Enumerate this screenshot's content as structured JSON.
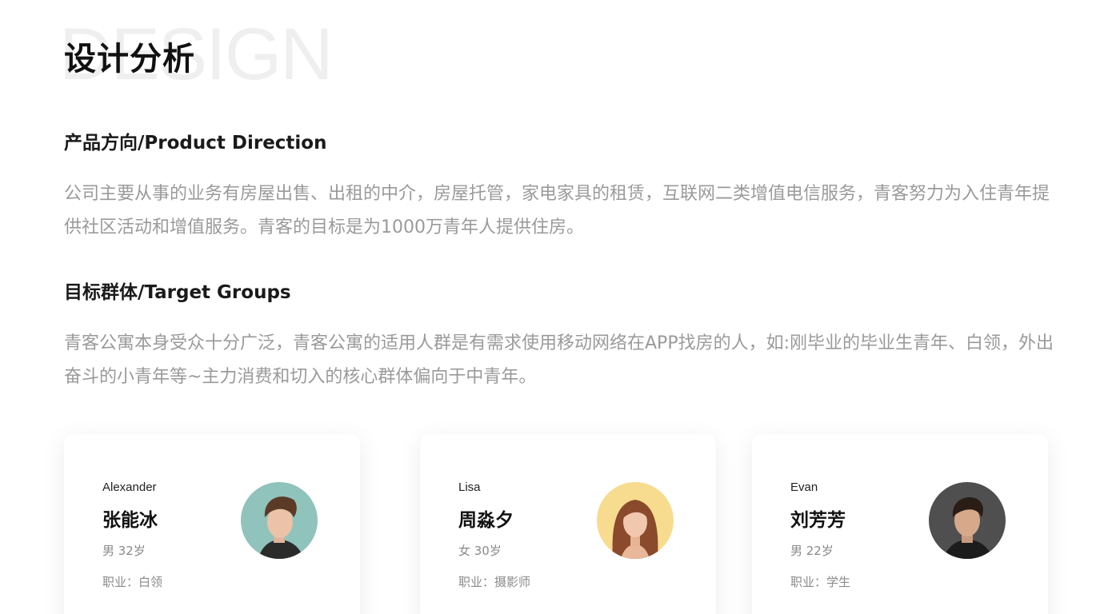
{
  "header": {
    "watermark": "DESIGN",
    "title": "设计分析"
  },
  "sections": [
    {
      "heading": "产品方向/Product Direction",
      "body": "公司主要从事的业务有房屋出售、出租的中介，房屋托管，家电家具的租赁，互联网二类增值电信服务，青客努力为入住青年提供社区活动和增值服务。青客的目标是为1000万青年人提供住房。"
    },
    {
      "heading": "目标群体/Target Groups",
      "body": "青客公寓本身受众十分广泛，青客公寓的适用人群是有需求使用移动网络在APP找房的人，如:刚毕业的毕业生青年、白领，外出奋斗的小青年等~主力消费和切入的核心群体偏向于中青年。"
    }
  ],
  "personas": [
    {
      "en_name": "Alexander",
      "cn_name": "张能冰",
      "gender_age": "男 32岁",
      "occupation": "职业：白领",
      "avatar_bg": "#8fc3bb",
      "avatar_icon": "male-portrait-icon"
    },
    {
      "en_name": "Lisa",
      "cn_name": "周淼夕",
      "gender_age": "女 30岁",
      "occupation": "职业：摄影师",
      "avatar_bg": "#f7dc8f",
      "avatar_icon": "female-portrait-icon"
    },
    {
      "en_name": "Evan",
      "cn_name": "刘芳芳",
      "gender_age": "男 22岁",
      "occupation": "职业：学生",
      "avatar_bg": "#4f4f4f",
      "avatar_icon": "male-portrait-icon"
    }
  ]
}
